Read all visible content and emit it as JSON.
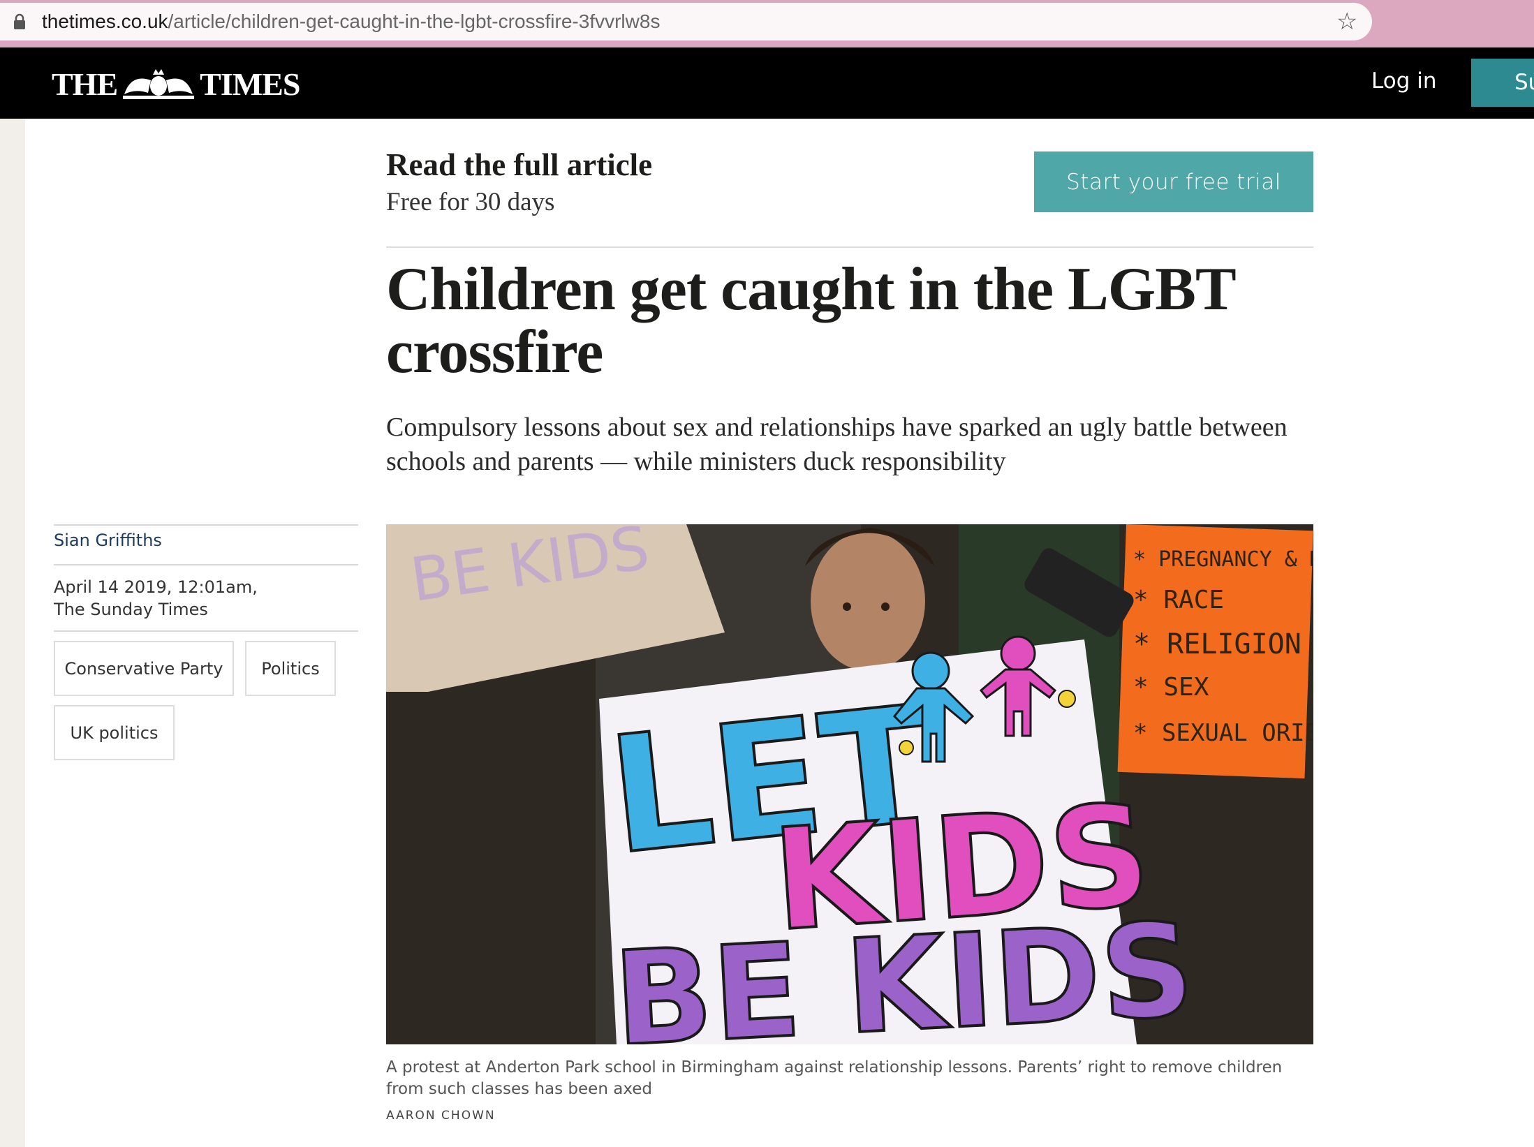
{
  "browser": {
    "url_domain": "thetimes.co.uk",
    "url_path": "/article/children-get-caught-in-the-lgbt-crossfire-3fvvrlw8s"
  },
  "header": {
    "logo_left": "THE",
    "logo_right": "TIMES",
    "login_label": "Log in",
    "subscribe_label": "Su"
  },
  "promo": {
    "title": "Read the full article",
    "subtitle": "Free for 30 days",
    "button_label": "Start your free trial"
  },
  "article": {
    "headline": "Children get caught in the LGBT crossfire",
    "standfirst": "Compulsory lessons about sex and relationships have sparked an ugly battle between schools and parents — while ministers duck responsibility",
    "author": "Sian Griffiths",
    "date_line1": "April 14 2019, 12:01am,",
    "date_line2": "The Sunday Times",
    "tags": [
      "Conservative Party",
      "Politics",
      "UK politics"
    ],
    "image": {
      "sign_left_text": "BE KIDS",
      "sign_center_lines": [
        "LET",
        "KIDS",
        "BE KIDS"
      ],
      "sign_right_lines": [
        "* PREGNANCY & MA",
        "* RACE",
        "* RELIGION OR",
        "* SEX",
        "* SEXUAL ORIE"
      ],
      "caption": "A protest at Anderton Park school in Birmingham against relationship lessons. Parents’ right to remove children from such classes has been axed",
      "credit": "AARON CHOWN"
    }
  },
  "colors": {
    "masthead_bg": "#000000",
    "accent_teal": "#4fa7a8",
    "subscribe_teal": "#2d8a91",
    "author_link": "#1b3a5c",
    "browser_frame": "#dca8bf"
  }
}
